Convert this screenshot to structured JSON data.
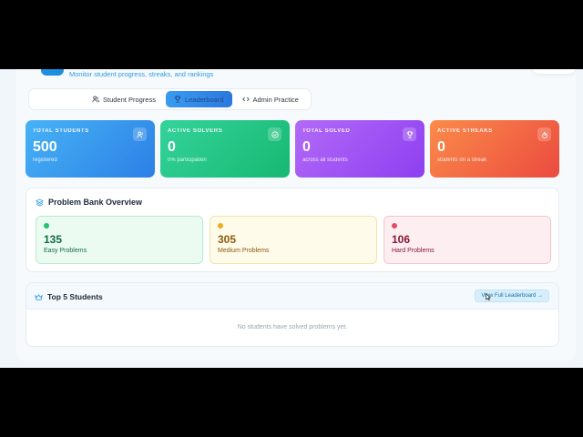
{
  "header": {
    "subtitle": "Monitor student progress, streaks, and rankings"
  },
  "tabs": [
    {
      "label": "Student Progress",
      "icon": "users-icon",
      "active": false
    },
    {
      "label": "Leaderboard",
      "icon": "trophy-icon",
      "active": true
    },
    {
      "label": "Admin Practice",
      "icon": "code-icon",
      "active": false
    }
  ],
  "stats": [
    {
      "label": "TOTAL STUDENTS",
      "value": "500",
      "sub": "registered",
      "icon": "users-icon"
    },
    {
      "label": "ACTIVE SOLVERS",
      "value": "0",
      "sub": "0% participation",
      "icon": "check-circle-icon"
    },
    {
      "label": "TOTAL SOLVED",
      "value": "0",
      "sub": "across all students",
      "icon": "trophy-icon"
    },
    {
      "label": "ACTIVE STREAKS",
      "value": "0",
      "sub": "students on a streak",
      "icon": "flame-icon"
    }
  ],
  "problem_bank": {
    "title": "Problem Bank Overview",
    "items": [
      {
        "count": "135",
        "label": "Easy Problems",
        "color": "#23c06e"
      },
      {
        "count": "305",
        "label": "Medium Problems",
        "color": "#efab1f"
      },
      {
        "count": "106",
        "label": "Hard Problems",
        "color": "#e14a6b"
      }
    ]
  },
  "top_students": {
    "title": "Top 5 Students",
    "view_button": "View Full Leaderboard →",
    "empty_text": "No students have solved problems yet."
  },
  "colors": {
    "accent": "#2c78de",
    "brand_text": "#2e9be0"
  }
}
